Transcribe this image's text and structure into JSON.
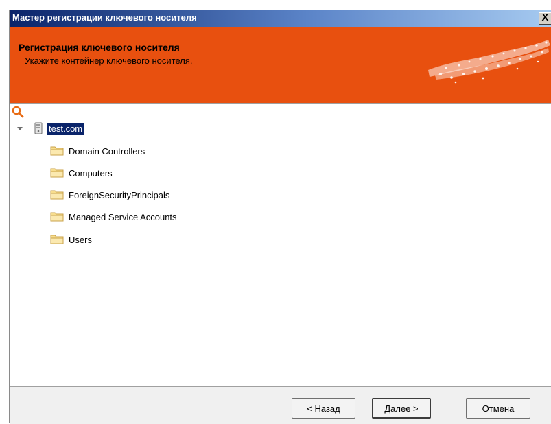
{
  "window": {
    "title": "Мастер регистрации ключевого носителя",
    "close_label": "X"
  },
  "banner": {
    "title": "Регистрация ключевого носителя",
    "subtitle": "Укажите контейнер ключевого носителя.",
    "background_color": "#e8500f"
  },
  "search": {
    "icon": "search-icon",
    "icon_color": "#e86a12"
  },
  "tree": {
    "root": {
      "label": "test.com",
      "icon": "server-icon",
      "expanded": true,
      "selected": true
    },
    "children": [
      {
        "label": "Domain Controllers",
        "icon": "folder-icon"
      },
      {
        "label": "Computers",
        "icon": "folder-icon"
      },
      {
        "label": "ForeignSecurityPrincipals",
        "icon": "folder-icon"
      },
      {
        "label": "Managed Service Accounts",
        "icon": "folder-icon"
      },
      {
        "label": "Users",
        "icon": "folder-icon"
      }
    ]
  },
  "footer": {
    "back_label": "< Назад",
    "next_label": "Далее >",
    "cancel_label": "Отмена"
  }
}
